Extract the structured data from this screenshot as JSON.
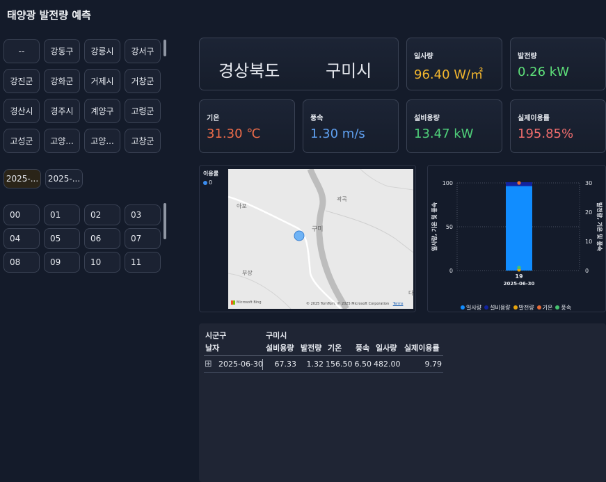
{
  "title": "태양광 발전량 예측",
  "region_slicer": {
    "items": [
      "--",
      "강동구",
      "강릉시",
      "강서구",
      "강진군",
      "강화군",
      "거제시",
      "거창군",
      "경산시",
      "경주시",
      "계양구",
      "고령군",
      "고성군",
      "고양...",
      "고양...",
      "고창군"
    ]
  },
  "date_slicer": {
    "items": [
      "2025-...",
      "2025-..."
    ]
  },
  "hour_slicer": {
    "items": [
      "00",
      "01",
      "02",
      "03",
      "04",
      "05",
      "06",
      "07",
      "08",
      "09",
      "10",
      "11"
    ]
  },
  "region_card": {
    "province": "경상북도",
    "city": "구미시"
  },
  "kpis": {
    "irradiance": {
      "label": "일사량",
      "value": "96.40 W/㎡",
      "color": "#f5b82e"
    },
    "generation": {
      "label": "발전량",
      "value": "0.26 kW",
      "color": "#5ee07a"
    },
    "temperature": {
      "label": "기온",
      "value": "31.30 ℃",
      "color": "#ef6d4a"
    },
    "wind": {
      "label": "풍속",
      "value": "1.30 m/s",
      "color": "#5fa0f0"
    },
    "capacity": {
      "label": "설비용량",
      "value": "13.47 kW",
      "color": "#4fd07a"
    },
    "utilization": {
      "label": "실제이용률",
      "value": "195.85%",
      "color": "#ef6d6d"
    }
  },
  "map": {
    "legend_title": "이용률",
    "legend_value": "0",
    "labels": {
      "apo": "아포",
      "gwakgok": "곽곡",
      "gumi": "구미",
      "busang": "부상",
      "d": "다"
    },
    "attribution": "© 2025 TomTom, © 2025 Microsoft Corporation",
    "terms": "Terms",
    "brand": "Microsoft Bing"
  },
  "chart_data": {
    "type": "bar",
    "categories": [
      "19"
    ],
    "category_sublabel": "2025-06-30",
    "ylabel_left": "일사량, 기온 및 풍속",
    "ylabel_right": "발전량, 기온 및 풍속",
    "ylim_left": [
      0,
      100
    ],
    "ylim_right": [
      0,
      30
    ],
    "left_ticks": [
      0,
      50,
      100
    ],
    "right_ticks": [
      0,
      10,
      20,
      30
    ],
    "series": [
      {
        "name": "일사량",
        "axis": "left",
        "type": "bar",
        "values": [
          96.4
        ],
        "color": "#118dff"
      },
      {
        "name": "설비용량",
        "axis": "right",
        "type": "bar_stacked",
        "values": [
          13.47
        ],
        "color": "#12239e"
      },
      {
        "name": "발전량",
        "axis": "right",
        "type": "point",
        "values": [
          0.26
        ],
        "color": "#e6a40c"
      },
      {
        "name": "기온",
        "axis": "right",
        "type": "point",
        "values": [
          31.3
        ],
        "color": "#e66c37"
      },
      {
        "name": "풍속",
        "axis": "right",
        "type": "point",
        "values": [
          1.3
        ],
        "color": "#46c26f"
      }
    ]
  },
  "table": {
    "row_header_label": "시군구",
    "date_header_label": "날자",
    "city": "구미시",
    "columns": [
      "설비용량",
      "발전량",
      "기온",
      "풍속",
      "일사량",
      "실제이용률"
    ],
    "rows": [
      {
        "date": "2025-06-30",
        "values": [
          "67.33",
          "1.32",
          "156.50",
          "6.50",
          "482.00",
          "9.79"
        ]
      }
    ],
    "expand_icon": "⊞"
  }
}
